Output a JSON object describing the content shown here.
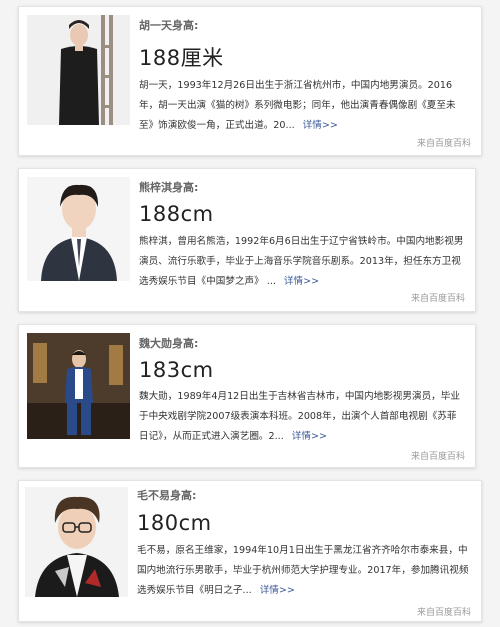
{
  "cards": [
    {
      "title": "胡一天身高:",
      "height": "188厘米",
      "desc": "胡一天，1993年12月26日出生于浙江省杭州市，中国内地男演员。2016年，胡一天出演《猫的树》系列微电影；同年，他出演青春偶像剧《夏至未至》饰演欧俊一角，正式出道。20...",
      "more": "详情>>",
      "source": "来自百度百科",
      "image_alt": "胡一天"
    },
    {
      "title": "熊梓淇身高:",
      "height": "188cm",
      "desc": "熊梓淇，曾用名熊浩，1992年6月6日出生于辽宁省铁岭市。中国内地影视男演员、流行乐歌手，毕业于上海音乐学院音乐剧系。2013年，担任东方卫视选秀娱乐节目《中国梦之声》 ...",
      "more": "详情>>",
      "source": "来自百度百科",
      "image_alt": "熊梓淇"
    },
    {
      "title": "魏大勋身高:",
      "height": "183cm",
      "desc": "魏大勋，1989年4月12日出生于吉林省吉林市，中国内地影视男演员，毕业于中央戏剧学院2007级表演本科班。2008年，出演个人首部电视剧《苏菲日记》，从而正式进入演艺圈。2...",
      "more": "详情>>",
      "source": "来自百度百科",
      "image_alt": "魏大勋"
    },
    {
      "title": "毛不易身高:",
      "height": "180cm",
      "desc": "毛不易，原名王维家，1994年10月1日出生于黑龙江省齐齐哈尔市泰来县，中国内地流行乐男歌手，毕业于杭州师范大学护理专业。2017年，参加腾讯视频选秀娱乐节目《明日之子...",
      "more": "详情>>",
      "source": "来自百度百科",
      "image_alt": "毛不易"
    }
  ]
}
